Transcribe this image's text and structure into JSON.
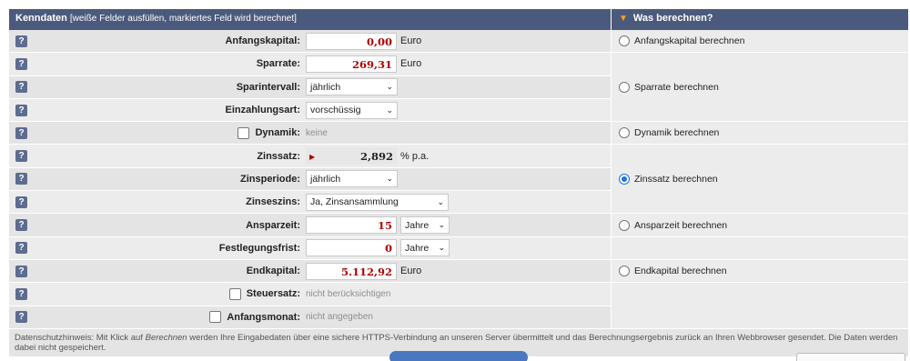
{
  "header": {
    "title": "Kenndaten",
    "subtitle": "[weiße Felder ausfüllen, markiertes Feld wird berechnet]",
    "right_title": "Was berechnen?"
  },
  "rows": [
    {
      "label": "Anfangskapital:",
      "value": "0,00",
      "unit": "Euro"
    },
    {
      "label": "Sparrate:",
      "value": "269,31",
      "unit": "Euro"
    },
    {
      "label": "Sparintervall:",
      "select": "jährlich"
    },
    {
      "label": "Einzahlungsart:",
      "select": "vorschüssig"
    },
    {
      "label": "Dynamik:",
      "muted": "keine"
    },
    {
      "label": "Zinssatz:",
      "value": "2,892",
      "unit": "% p.a."
    },
    {
      "label": "Zinsperiode:",
      "select": "jährlich"
    },
    {
      "label": "Zinseszins:",
      "select": "Ja, Zinsansammlung"
    },
    {
      "label": "Ansparzeit:",
      "value": "15",
      "select": "Jahre"
    },
    {
      "label": "Festlegungsfrist:",
      "value": "0",
      "select": "Jahre"
    },
    {
      "label": "Endkapital:",
      "value": "5.112,92",
      "unit": "Euro"
    },
    {
      "label": "Steuersatz:",
      "muted": "nicht berücksichtigen"
    },
    {
      "label": "Anfangsmonat:",
      "muted": "nicht angegeben"
    }
  ],
  "help_glyph": "?",
  "radios": [
    {
      "label": "Anfangskapital berechnen",
      "checked": false
    },
    {
      "label": "Sparrate berechnen",
      "checked": false
    },
    {
      "label": "Dynamik berechnen",
      "checked": false
    },
    {
      "label": "Zinssatz berechnen",
      "checked": true
    },
    {
      "label": "Ansparzeit berechnen",
      "checked": false
    },
    {
      "label": "Endkapital berechnen",
      "checked": false
    }
  ],
  "footer": {
    "before": "Datenschutzhinweis: Mit Klick auf ",
    "emph": "Berechnen",
    "after": " werden Ihre Eingabedaten über eine sichere HTTPS-Verbindung an unseren Server übermittelt und das Berechnungsergebnis zurück an Ihren Webbrowser gesendet. Die Daten werden dabei nicht gespeichert."
  },
  "colors": {
    "header": "#4b5a7c",
    "accent": "#f2a51e",
    "value": "#b30000"
  }
}
